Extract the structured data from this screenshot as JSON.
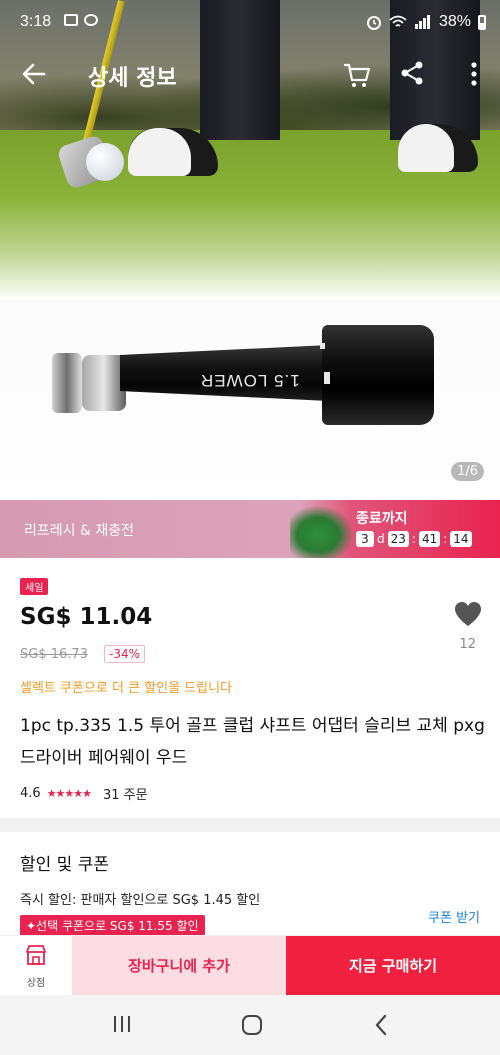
{
  "status_bar": {
    "time": "3:18",
    "battery": "38%"
  },
  "app_bar": {
    "title": "상세 정보"
  },
  "product_image": {
    "adapter_text": "1.5 LOWER",
    "page_indicator": "1/6"
  },
  "promo": {
    "left_text": "리프레시 & 재충전",
    "end_label": "종료까지",
    "countdown": {
      "days": "3",
      "day_unit": "d",
      "hours": "23",
      "minutes": "41",
      "seconds": "14"
    }
  },
  "price": {
    "badge": "세일",
    "current": "SG$ 11.04",
    "original": "SG$ 16.73",
    "discount": "-34%",
    "like_count": "12",
    "coupon_note": "셀렉트 쿠폰으로 더 큰 할인을 드립니다"
  },
  "product": {
    "title": "1pc tp.335 1.5 투어 골프 클럽 샤프트 어댑터 슬리브 교체 pxg 드라이버 페어웨이 우드",
    "rating": "4.6",
    "stars": "★★★★★",
    "orders": "31 주문"
  },
  "discount_section": {
    "title": "할인 및 쿠폰",
    "instant": "즉시 할인: 판매자 할인으로 SG$ 1.45 할인",
    "coupon_chip": "✦선택 쿠폰으로 SG$ 11.55 할인",
    "coupon_link": "쿠폰 받기"
  },
  "bottom_bar": {
    "store_label": "상점",
    "add_to_cart": "장바구니에 추가",
    "buy_now": "지금 구매하기"
  },
  "colors": {
    "accent": "#e8234f",
    "buy_now_bg": "#f0213f",
    "add_cart_bg": "#fcdde4",
    "coupon_note": "#f39a21",
    "link": "#1a7fd6"
  }
}
